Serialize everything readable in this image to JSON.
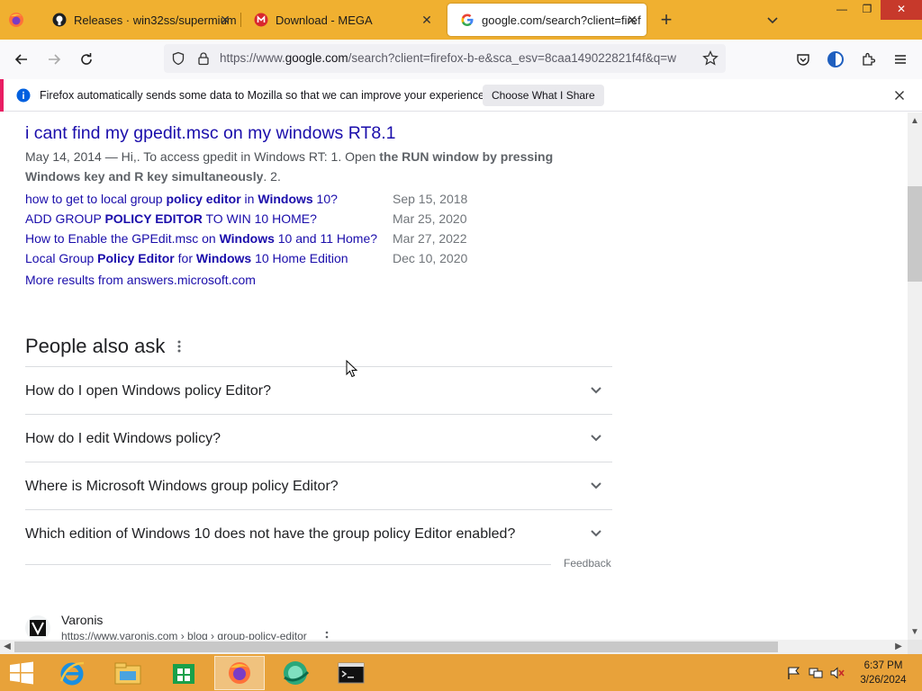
{
  "browser": {
    "tabs": [
      {
        "title": "Releases · win32ss/supermium",
        "favicon": "github-icon"
      },
      {
        "title": "Download - MEGA",
        "favicon": "mega-icon"
      },
      {
        "title": "google.com/search?client=firef",
        "favicon": "google-icon"
      }
    ],
    "url": {
      "prefix": "https://www.",
      "host": "google.com",
      "rest": "/search?client=firefox-b-e&sca_esv=8caa149022821f4f&q=w"
    },
    "notification": {
      "text": "Firefox automatically sends some data to Mozilla so that we can improve your experience.",
      "button": "Choose What I Share"
    }
  },
  "result": {
    "title": "i cant find my gpedit.msc on my windows RT8.1",
    "snippet_date": "May 14, 2014",
    "snippet_plain": " — Hi,. To access gpedit in Windows RT: 1. Open ",
    "snippet_bold1": "the RUN window by pressing Windows key and R key simultaneously",
    "snippet_end": ". 2.",
    "sublinks": [
      {
        "parts": [
          {
            "t": "how to get to local group ",
            "b": false
          },
          {
            "t": "policy editor",
            "b": true
          },
          {
            "t": " in ",
            "b": false
          },
          {
            "t": "Windows",
            "b": true
          },
          {
            "t": " 10?",
            "b": false
          }
        ],
        "date": "Sep 15, 2018"
      },
      {
        "parts": [
          {
            "t": "ADD GROUP ",
            "b": false
          },
          {
            "t": "POLICY EDITOR",
            "b": true
          },
          {
            "t": " TO WIN 10 HOME?",
            "b": false
          }
        ],
        "date": "Mar 25, 2020"
      },
      {
        "parts": [
          {
            "t": "How to Enable the GPEdit.msc on ",
            "b": false
          },
          {
            "t": "Windows",
            "b": true
          },
          {
            "t": " 10 and 11 Home?",
            "b": false
          }
        ],
        "date": "Mar 27, 2022"
      },
      {
        "parts": [
          {
            "t": "Local Group ",
            "b": false
          },
          {
            "t": "Policy Editor",
            "b": true
          },
          {
            "t": " for ",
            "b": false
          },
          {
            "t": "Windows",
            "b": true
          },
          {
            "t": " 10 Home Edition",
            "b": false
          }
        ],
        "date": "Dec 10, 2020"
      }
    ],
    "more_results": "More results from answers.microsoft.com"
  },
  "people_also_ask": {
    "title": "People also ask",
    "questions": [
      "How do I open Windows policy Editor?",
      "How do I edit Windows policy?",
      "Where is Microsoft Windows group policy Editor?",
      "Which edition of Windows 10 does not have the group policy Editor enabled?"
    ],
    "feedback": "Feedback"
  },
  "next_result": {
    "site_name": "Varonis",
    "site_url": "https://www.varonis.com › blog › group-policy-editor"
  },
  "taskbar": {
    "apps": [
      "internet-explorer-icon",
      "file-explorer-icon",
      "store-icon",
      "firefox-icon",
      "browser-icon",
      "cmd-icon"
    ],
    "time": "6:37 PM",
    "date": "3/26/2024"
  },
  "colors": {
    "tabstrip": "#f0b030",
    "taskbar": "#e8a23a",
    "link": "#1a0dab",
    "accent": "#e91e63"
  }
}
